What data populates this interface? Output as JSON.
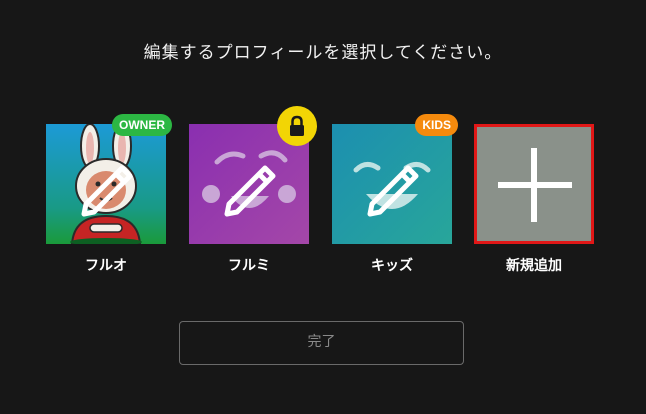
{
  "header": {
    "title": "編集するプロフィールを選択してください。"
  },
  "profiles": [
    {
      "name": "フルオ",
      "badge": "OWNER",
      "avatar": "rabbit-avatar",
      "edit_icon": "pencil-icon",
      "colors": {
        "bg_top": "#1c9ad6",
        "bg_bottom": "#1a9a3a",
        "badge": "#2cb743"
      }
    },
    {
      "name": "フルミ",
      "badge_icon": "lock-icon",
      "avatar": "face-avatar",
      "edit_icon": "pencil-icon",
      "colors": {
        "bg_top": "#8a2fb0",
        "bg_bottom": "#a447a8",
        "lock": "#f2d505"
      }
    },
    {
      "name": "キッズ",
      "badge": "KIDS",
      "avatar": "face-avatar",
      "edit_icon": "pencil-icon",
      "colors": {
        "bg_top": "#1c8fb0",
        "bg_bottom": "#28a69a",
        "badge": "#f58a0d"
      }
    }
  ],
  "add_profile": {
    "label": "新規追加",
    "icon": "plus-icon",
    "colors": {
      "bg": "#8a918a",
      "selected_border": "#e11717"
    }
  },
  "done_button": {
    "label": "完了"
  },
  "colors": {
    "background": "#171717",
    "text": "#ffffff",
    "button_border": "#6a6a6a",
    "button_text": "#8a8a8a"
  }
}
